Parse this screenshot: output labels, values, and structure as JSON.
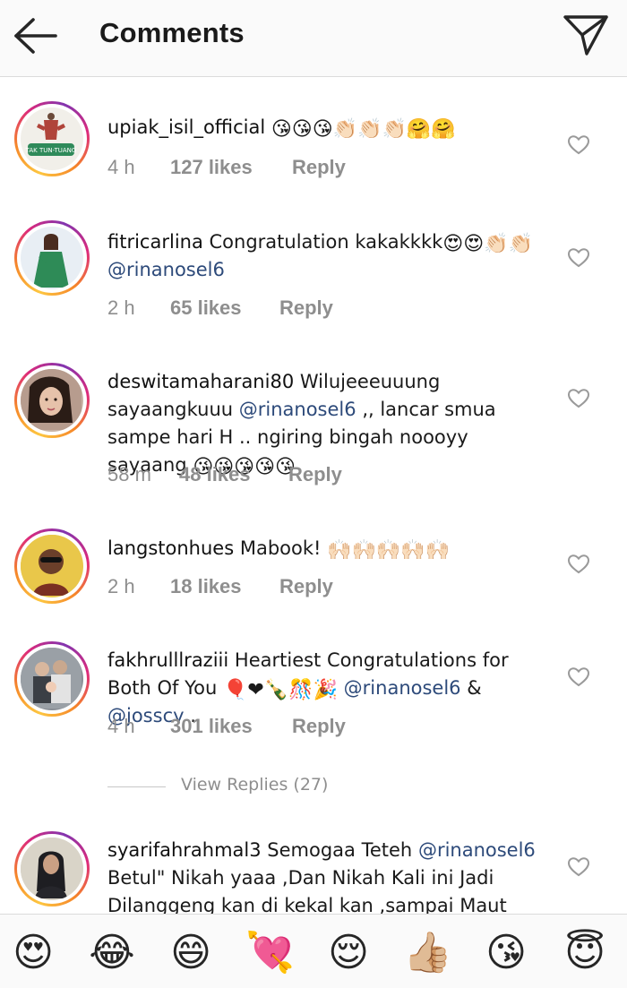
{
  "header": {
    "title": "Comments",
    "back_icon": "arrow-left-icon",
    "send_icon": "paper-plane-icon"
  },
  "comments": [
    {
      "username": "upiak_isil_official",
      "text": "",
      "emojis": "😘😘😘👏🏻👏🏻👏🏻🤗🤗",
      "time": "4 h",
      "likes": "127 likes",
      "reply": "Reply",
      "avatar_caption": "TAK TUN-TUANG"
    },
    {
      "username": "fitricarlina",
      "text": "Congratulation kakakkkk",
      "emojis": "😍😍👏🏻👏🏻",
      "mention": "@rinanosel6",
      "time": "2 h",
      "likes": "65 likes",
      "reply": "Reply"
    },
    {
      "username": "deswitamaharani80",
      "text": "Wilujeeeuuung sayaangkuuu",
      "mention": "@rinanosel6",
      "text2": ",, lancar smua sampe hari H .. ngiring bingah noooyy sayaang",
      "emojis": "😘😘😘😘😘",
      "time": "58 m",
      "likes": "48 likes",
      "reply": "Reply"
    },
    {
      "username": "langstonhues",
      "text": "Mabook!",
      "emojis": "🙌🏻🙌🏻🙌🏻🙌🏻🙌🏻",
      "time": "2 h",
      "likes": "18 likes",
      "reply": "Reply"
    },
    {
      "username": "fakhrulllraziii",
      "text": "Heartiest Congratulations for Both Of You",
      "emojis": "🎈❤🍾🎊🎉",
      "mention": "@rinanosel6",
      "and": "&",
      "mention2": "@josscy",
      "end": ".",
      "time": "4 h",
      "likes": "301 likes",
      "reply": "Reply",
      "view_replies": "View Replies (27)"
    },
    {
      "username": "syarifahrahmal3",
      "text": "Semogaa Teteh",
      "mention": "@rinanosel6",
      "text2": "Betul\" Nikah yaaa ,Dan Nikah Kali ini Jadi Dilanggeng kan di kekal kan ,sampai Maut Memisahkan"
    }
  ],
  "emoji_bar": [
    {
      "glyph": "😍",
      "name": "heart-eyes-emoji-icon"
    },
    {
      "glyph": "😂",
      "name": "tears-of-joy-emoji-icon"
    },
    {
      "glyph": "😄",
      "name": "grinning-emoji-icon"
    },
    {
      "glyph": "💘",
      "name": "heart-arrow-emoji-icon"
    },
    {
      "glyph": "😌",
      "name": "relieved-emoji-icon"
    },
    {
      "glyph": "👍🏼",
      "name": "thumbs-up-emoji-icon"
    },
    {
      "glyph": "😘",
      "name": "kiss-emoji-icon"
    },
    {
      "glyph": "😇",
      "name": "angel-emoji-icon"
    }
  ],
  "colors": {
    "mention": "#2d4a7a",
    "meta": "#8e8e8e",
    "border": "#dbdbdb"
  }
}
